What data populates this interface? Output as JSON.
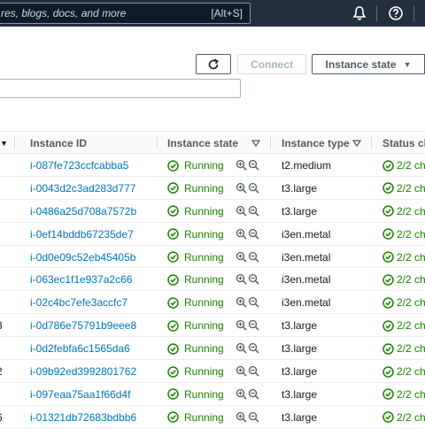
{
  "nav": {
    "search_placeholder": "res, blogs, docs, and more",
    "search_shortcut": "[Alt+S]"
  },
  "toolbar": {
    "connect_label": "Connect",
    "instance_state_label": "Instance state"
  },
  "table": {
    "headers": {
      "instance_id": "Instance ID",
      "instance_state": "Instance state",
      "instance_type": "Instance type",
      "status_check": "Status ch"
    },
    "rows": [
      {
        "partial": "",
        "id": "i-087fe723ccfcabba5",
        "state": "Running",
        "type": "t2.medium",
        "status": "2/2 ch"
      },
      {
        "partial": "",
        "id": "i-0043d2c3ad283d777",
        "state": "Running",
        "type": "t3.large",
        "status": "2/2 ch"
      },
      {
        "partial": "",
        "id": "i-0486a25d708a7572b",
        "state": "Running",
        "type": "t3.large",
        "status": "2/2 ch"
      },
      {
        "partial": "",
        "id": "i-0ef14bddb67235de7",
        "state": "Running",
        "type": "i3en.metal",
        "status": "2/2 ch"
      },
      {
        "partial": "",
        "id": "i-0d0e09c52eb45405b",
        "state": "Running",
        "type": "i3en.metal",
        "status": "2/2 ch"
      },
      {
        "partial": "",
        "id": "i-063ec1f1e937a2c66",
        "state": "Running",
        "type": "i3en.metal",
        "status": "2/2 ch"
      },
      {
        "partial": "",
        "id": "i-02c4bc7efe3accfc7",
        "state": "Running",
        "type": "i3en.metal",
        "status": "2/2 ch"
      },
      {
        "partial": "3",
        "id": "i-0d786e75791b9eee8",
        "state": "Running",
        "type": "t3.large",
        "status": "2/2 ch"
      },
      {
        "partial": "",
        "id": "i-0d2febfa6c1565da6",
        "state": "Running",
        "type": "t3.large",
        "status": "2/2 ch"
      },
      {
        "partial": "2",
        "id": "i-09b92ed3992801762",
        "state": "Running",
        "type": "t3.large",
        "status": "2/2 ch"
      },
      {
        "partial": "",
        "id": "i-097eaa75aa1f66d4f",
        "state": "Running",
        "type": "t3.large",
        "status": "2/2 ch"
      },
      {
        "partial": "6",
        "id": "i-01321db72683bdbb6",
        "state": "Running",
        "type": "t3.large",
        "status": "2/2 ch"
      }
    ]
  },
  "colors": {
    "nav_bg": "#232f3e",
    "link": "#0073bb",
    "success": "#1d8102"
  }
}
